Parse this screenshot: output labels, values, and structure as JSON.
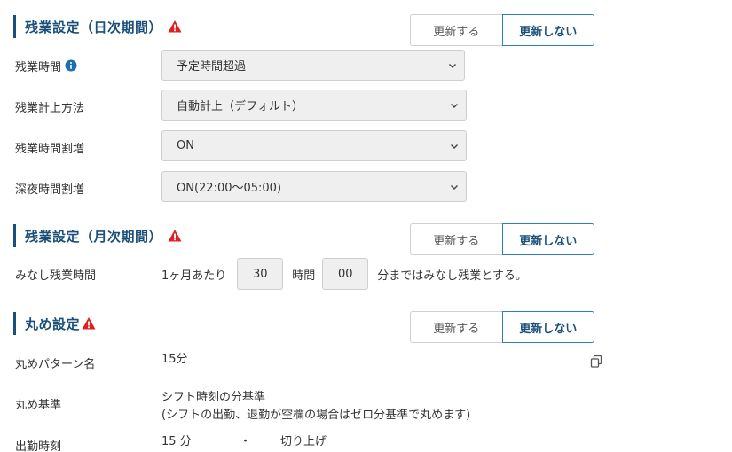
{
  "sections": {
    "daily": {
      "title": "残業設定（日次期間）"
    },
    "monthly": {
      "title": "残業設定（月次期間）"
    },
    "rounding": {
      "title": "丸め設定"
    }
  },
  "toggle": {
    "update": "更新する",
    "no_update": "更新しない"
  },
  "daily_fields": {
    "overtime_time": {
      "label": "残業時間",
      "value": "予定時間超過"
    },
    "overtime_method": {
      "label": "残業計上方法",
      "value": "自動計上（デフォルト）"
    },
    "overtime_premium": {
      "label": "残業時間割増",
      "value": "ON"
    },
    "night_premium": {
      "label": "深夜時間割増",
      "value": "ON(22:00〜05:00)"
    }
  },
  "monthly_fields": {
    "deemed_label": "みなし残業時間",
    "per_month": "1ヶ月あたり",
    "hours": "30",
    "hours_unit": "時間",
    "minutes": "00",
    "suffix": "分まではみなし残業とする。"
  },
  "rounding_fields": {
    "pattern_label": "丸めパターン名",
    "pattern_value": "15分",
    "basis_label": "丸め基準",
    "basis_line1": "シフト時刻の分基準",
    "basis_line2": "(シフトの出勤、退勤が空欄の場合はゼロ分基準で丸めます)",
    "clock_in_label": "出勤時刻",
    "clock_in_value": "15 分",
    "clock_in_sep": "・",
    "clock_in_mode": "切り上げ"
  },
  "colors": {
    "accent": "#1a4f7a",
    "warning": "#e02020",
    "active_border": "#2f7fc0",
    "field_bg": "#efefef"
  }
}
